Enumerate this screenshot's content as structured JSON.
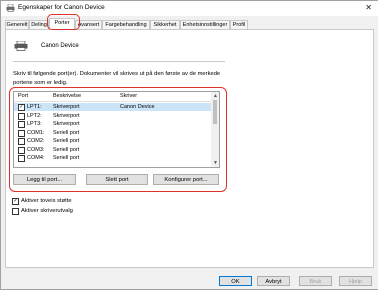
{
  "window": {
    "title": "Egenskaper for Canon Device",
    "close_glyph": "✕"
  },
  "tabs": [
    {
      "label": "Generelt"
    },
    {
      "label": "Deling"
    },
    {
      "label": "Porter"
    },
    {
      "label": "Avansert"
    },
    {
      "label": "Fargebehandling"
    },
    {
      "label": "Sikkerhet"
    },
    {
      "label": "Enhetsinnstillinger"
    },
    {
      "label": "Profil"
    }
  ],
  "device": {
    "name": "Canon Device"
  },
  "instruction": "Skriv til følgende port(er). Dokumenter vil skrives ut på den første av de merkede portene som er ledig.",
  "ports": {
    "columns": [
      "Port",
      "Beskrivelse",
      "Skriver"
    ],
    "rows": [
      {
        "port": "LPT1:",
        "description": "Skriverport",
        "printer": "Canon Device",
        "checked": true,
        "selected": true
      },
      {
        "port": "LPT2:",
        "description": "Skriverport",
        "printer": "",
        "checked": false,
        "selected": false
      },
      {
        "port": "LPT3:",
        "description": "Skriverport",
        "printer": "",
        "checked": false,
        "selected": false
      },
      {
        "port": "COM1:",
        "description": "Seriell port",
        "printer": "",
        "checked": false,
        "selected": false
      },
      {
        "port": "COM2:",
        "description": "Seriell port",
        "printer": "",
        "checked": false,
        "selected": false
      },
      {
        "port": "COM3:",
        "description": "Seriell port",
        "printer": "",
        "checked": false,
        "selected": false
      },
      {
        "port": "COM4:",
        "description": "Seriell port",
        "printer": "",
        "checked": false,
        "selected": false
      }
    ]
  },
  "port_buttons": {
    "add": "Legg til port...",
    "delete": "Slett port",
    "configure": "Konfigurer port..."
  },
  "options": {
    "bidirectional": {
      "label": "Aktiver toveis støtte",
      "checked": true
    },
    "pooling": {
      "label": "Aktiver skriverutvalg",
      "checked": false
    }
  },
  "footer": {
    "ok": "OK",
    "cancel": "Avbryt",
    "apply": "Bruk",
    "help": "Hjelp"
  },
  "colors": {
    "highlight": "#e0302a",
    "selection": "#cce4f7"
  }
}
